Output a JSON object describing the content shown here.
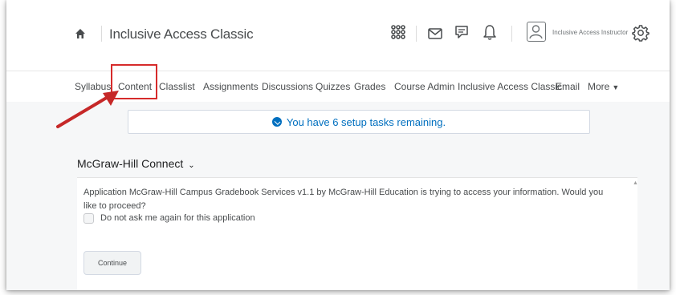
{
  "header": {
    "home_icon": "home-icon",
    "course_title": "Inclusive Access Classic",
    "icons": [
      "grid-icon",
      "mail-icon",
      "chat-icon",
      "bell-icon"
    ],
    "user_name": "Inclusive Access Instructor",
    "settings_icon": "gear-icon"
  },
  "nav": {
    "items": [
      "Syllabus",
      "Content",
      "Classlist",
      "Assignments",
      "Discussions",
      "Quizzes",
      "Grades",
      "Course Admin",
      "Inclusive Access Classic",
      "Email",
      "More"
    ],
    "highlighted": "Content"
  },
  "banner": {
    "text": "You have 6 setup tasks remaining."
  },
  "widget": {
    "title": "McGraw-Hill Connect",
    "message": "Application McGraw-Hill Campus Gradebook Services v1.1 by McGraw-Hill Education is trying to access your information. Would you like to proceed?",
    "checkbox_label": "Do not ask me again for this application",
    "continue_label": "Continue"
  },
  "colors": {
    "annotation_red": "#d62b2b",
    "info_blue": "#006fbf"
  }
}
